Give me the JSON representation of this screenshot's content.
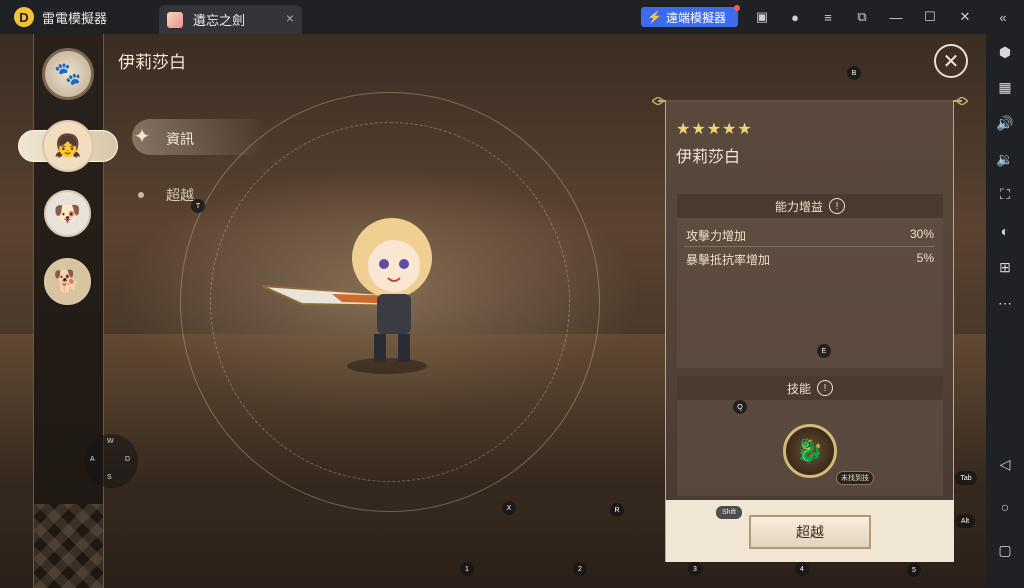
{
  "titlebar": {
    "app_name": "雷電模擬器",
    "tab_label": "遺忘之劍",
    "remote_label": "遠端模擬器",
    "tab_close_icon": "×",
    "icons": [
      "store-icon",
      "user-icon",
      "menu-icon",
      "popout-icon",
      "minimize-icon",
      "maximize-icon",
      "close-icon",
      "collapse-icon"
    ]
  },
  "sidebar": {
    "icons": [
      "settings-icon",
      "keyboard-icon",
      "volume-up-icon",
      "volume-down-icon",
      "screenshot-icon",
      "gamepad-icon",
      "multi-instance-icon",
      "more-icon",
      "back-icon",
      "home-icon",
      "recent-apps-icon"
    ]
  },
  "game": {
    "character_title": "伊莉莎白",
    "menu": {
      "info": "資訊",
      "exceed": "超越"
    },
    "card": {
      "stars": "★★★★★",
      "name": "伊莉莎白",
      "ability_header": "能力增益",
      "stats": [
        {
          "label": "攻擊力增加",
          "value": "30%"
        },
        {
          "label": "暴擊抵抗率增加",
          "value": "5%"
        }
      ],
      "skill_header": "技能",
      "skill_tag": "未找到技",
      "exceed_button": "超越"
    },
    "keys": {
      "b": "B",
      "t": "T",
      "e": "E",
      "q": "Q",
      "x": "X",
      "r": "R",
      "tab": "Tab",
      "alt": "Alt",
      "shift": "Shift",
      "k1": "1",
      "k2": "2",
      "k3": "3",
      "k4": "4",
      "k5": "5",
      "w": "W",
      "a": "A",
      "s": "S",
      "d": "D"
    },
    "colors": {
      "accent": "#c9a96a",
      "remote": "#3b6cf0",
      "star": "#f3d37a"
    }
  }
}
